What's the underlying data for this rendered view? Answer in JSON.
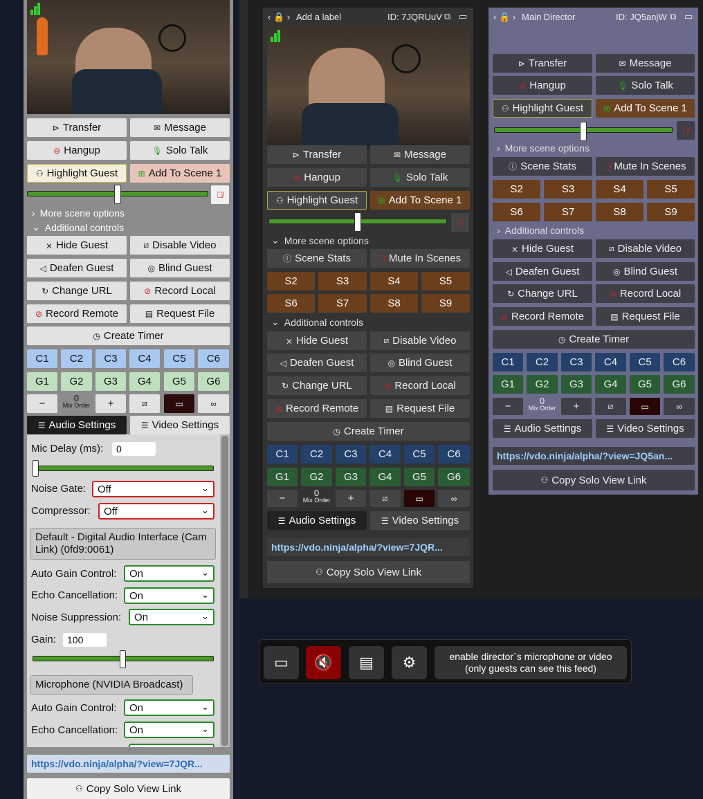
{
  "left_panel": {
    "actions": {
      "transfer": "Transfer",
      "message": "Message",
      "hangup": "Hangup",
      "solo_talk": "Solo Talk",
      "highlight": "Highlight Guest",
      "add_scene": "Add To Scene 1"
    },
    "more_scene": "More scene options",
    "additional": "Additional controls",
    "controls": {
      "hide": "Hide Guest",
      "disable_video": "Disable Video",
      "deafen": "Deafen Guest",
      "blind": "Blind Guest",
      "change_url": "Change URL",
      "record_local": "Record Local",
      "record_remote": "Record Remote",
      "request_file": "Request File",
      "create_timer": "Create Timer"
    },
    "c_buttons": [
      "C1",
      "C2",
      "C3",
      "C4",
      "C5",
      "C6"
    ],
    "g_buttons": [
      "G1",
      "G2",
      "G3",
      "G4",
      "G5",
      "G6"
    ],
    "mix_value": "0",
    "mix_label": "Mix Order",
    "audio_settings": "Audio Settings",
    "video_settings": "Video Settings",
    "mic_delay_label": "Mic Delay (ms):",
    "mic_delay_value": "0",
    "noise_gate_label": "Noise Gate:",
    "noise_gate_value": "Off",
    "compressor_label": "Compressor:",
    "compressor_value": "Off",
    "device1": "Default - Digital Audio Interface (Cam Link) (0fd9:0061)",
    "agc_label": "Auto Gain Control:",
    "agc_value": "On",
    "echo_label": "Echo Cancellation:",
    "echo_value": "On",
    "ns_label": "Noise Suppression:",
    "ns_value": "On",
    "gain_label": "Gain:",
    "gain_value": "100",
    "device2": "Microphone (NVIDIA Broadcast)",
    "agc2_value": "On",
    "echo2_value": "On",
    "link": "https://vdo.ninja/alpha/?view=7JQR...",
    "copy_link": "Copy Solo View Link"
  },
  "middle_panel": {
    "label": "Add a label",
    "id": "ID: 7JQRUuV",
    "actions": {
      "transfer": "Transfer",
      "message": "Message",
      "hangup": "Hangup",
      "solo_talk": "Solo Talk",
      "highlight": "Highlight Guest",
      "add_scene": "Add To Scene 1"
    },
    "more_scene": "More scene options",
    "scene_stats": "Scene Stats",
    "mute_scenes": "Mute In Scenes",
    "scenes": [
      "S2",
      "S3",
      "S4",
      "S5",
      "S6",
      "S7",
      "S8",
      "S9"
    ],
    "additional": "Additional controls",
    "controls": {
      "hide": "Hide Guest",
      "disable_video": "Disable Video",
      "deafen": "Deafen Guest",
      "blind": "Blind Guest",
      "change_url": "Change URL",
      "record_local": "Record Local",
      "record_remote": "Record Remote",
      "request_file": "Request File",
      "create_timer": "Create Timer"
    },
    "c_buttons": [
      "C1",
      "C2",
      "C3",
      "C4",
      "C5",
      "C6"
    ],
    "g_buttons": [
      "G1",
      "G2",
      "G3",
      "G4",
      "G5",
      "G6"
    ],
    "mix_value": "0",
    "mix_label": "Mix Order",
    "audio_settings": "Audio Settings",
    "video_settings": "Video Settings",
    "link": "https://vdo.ninja/alpha/?view=7JQR...",
    "copy_link": "Copy Solo View Link"
  },
  "right_panel": {
    "label": "Main Director",
    "id": "ID: JQ5anjW",
    "actions": {
      "transfer": "Transfer",
      "message": "Message",
      "hangup": "Hangup",
      "solo_talk": "Solo Talk",
      "highlight": "Highlight Guest",
      "add_scene": "Add To Scene 1"
    },
    "more_scene": "More scene options",
    "scene_stats": "Scene Stats",
    "mute_scenes": "Mute In Scenes",
    "scenes": [
      "S2",
      "S3",
      "S4",
      "S5",
      "S6",
      "S7",
      "S8",
      "S9"
    ],
    "additional": "Additional controls",
    "controls": {
      "hide": "Hide Guest",
      "disable_video": "Disable Video",
      "deafen": "Deafen Guest",
      "blind": "Blind Guest",
      "change_url": "Change URL",
      "record_local": "Record Local",
      "record_remote": "Record Remote",
      "request_file": "Request File",
      "create_timer": "Create Timer"
    },
    "c_buttons": [
      "C1",
      "C2",
      "C3",
      "C4",
      "C5",
      "C6"
    ],
    "g_buttons": [
      "G1",
      "G2",
      "G3",
      "G4",
      "G5",
      "G6"
    ],
    "mix_value": "0",
    "mix_label": "Mix Order",
    "audio_settings": "Audio Settings",
    "video_settings": "Video Settings",
    "link": "https://vdo.ninja/alpha/?view=JQ5an...",
    "copy_link": "Copy Solo View Link"
  },
  "toolbar": {
    "enable_line1": "enable director`s microphone or video",
    "enable_line2": "(only guests can see this feed)"
  },
  "colors": {
    "link_light": "#2f6db8",
    "link_dark": "#9fd0ff",
    "muted_red": "#8b0000"
  }
}
